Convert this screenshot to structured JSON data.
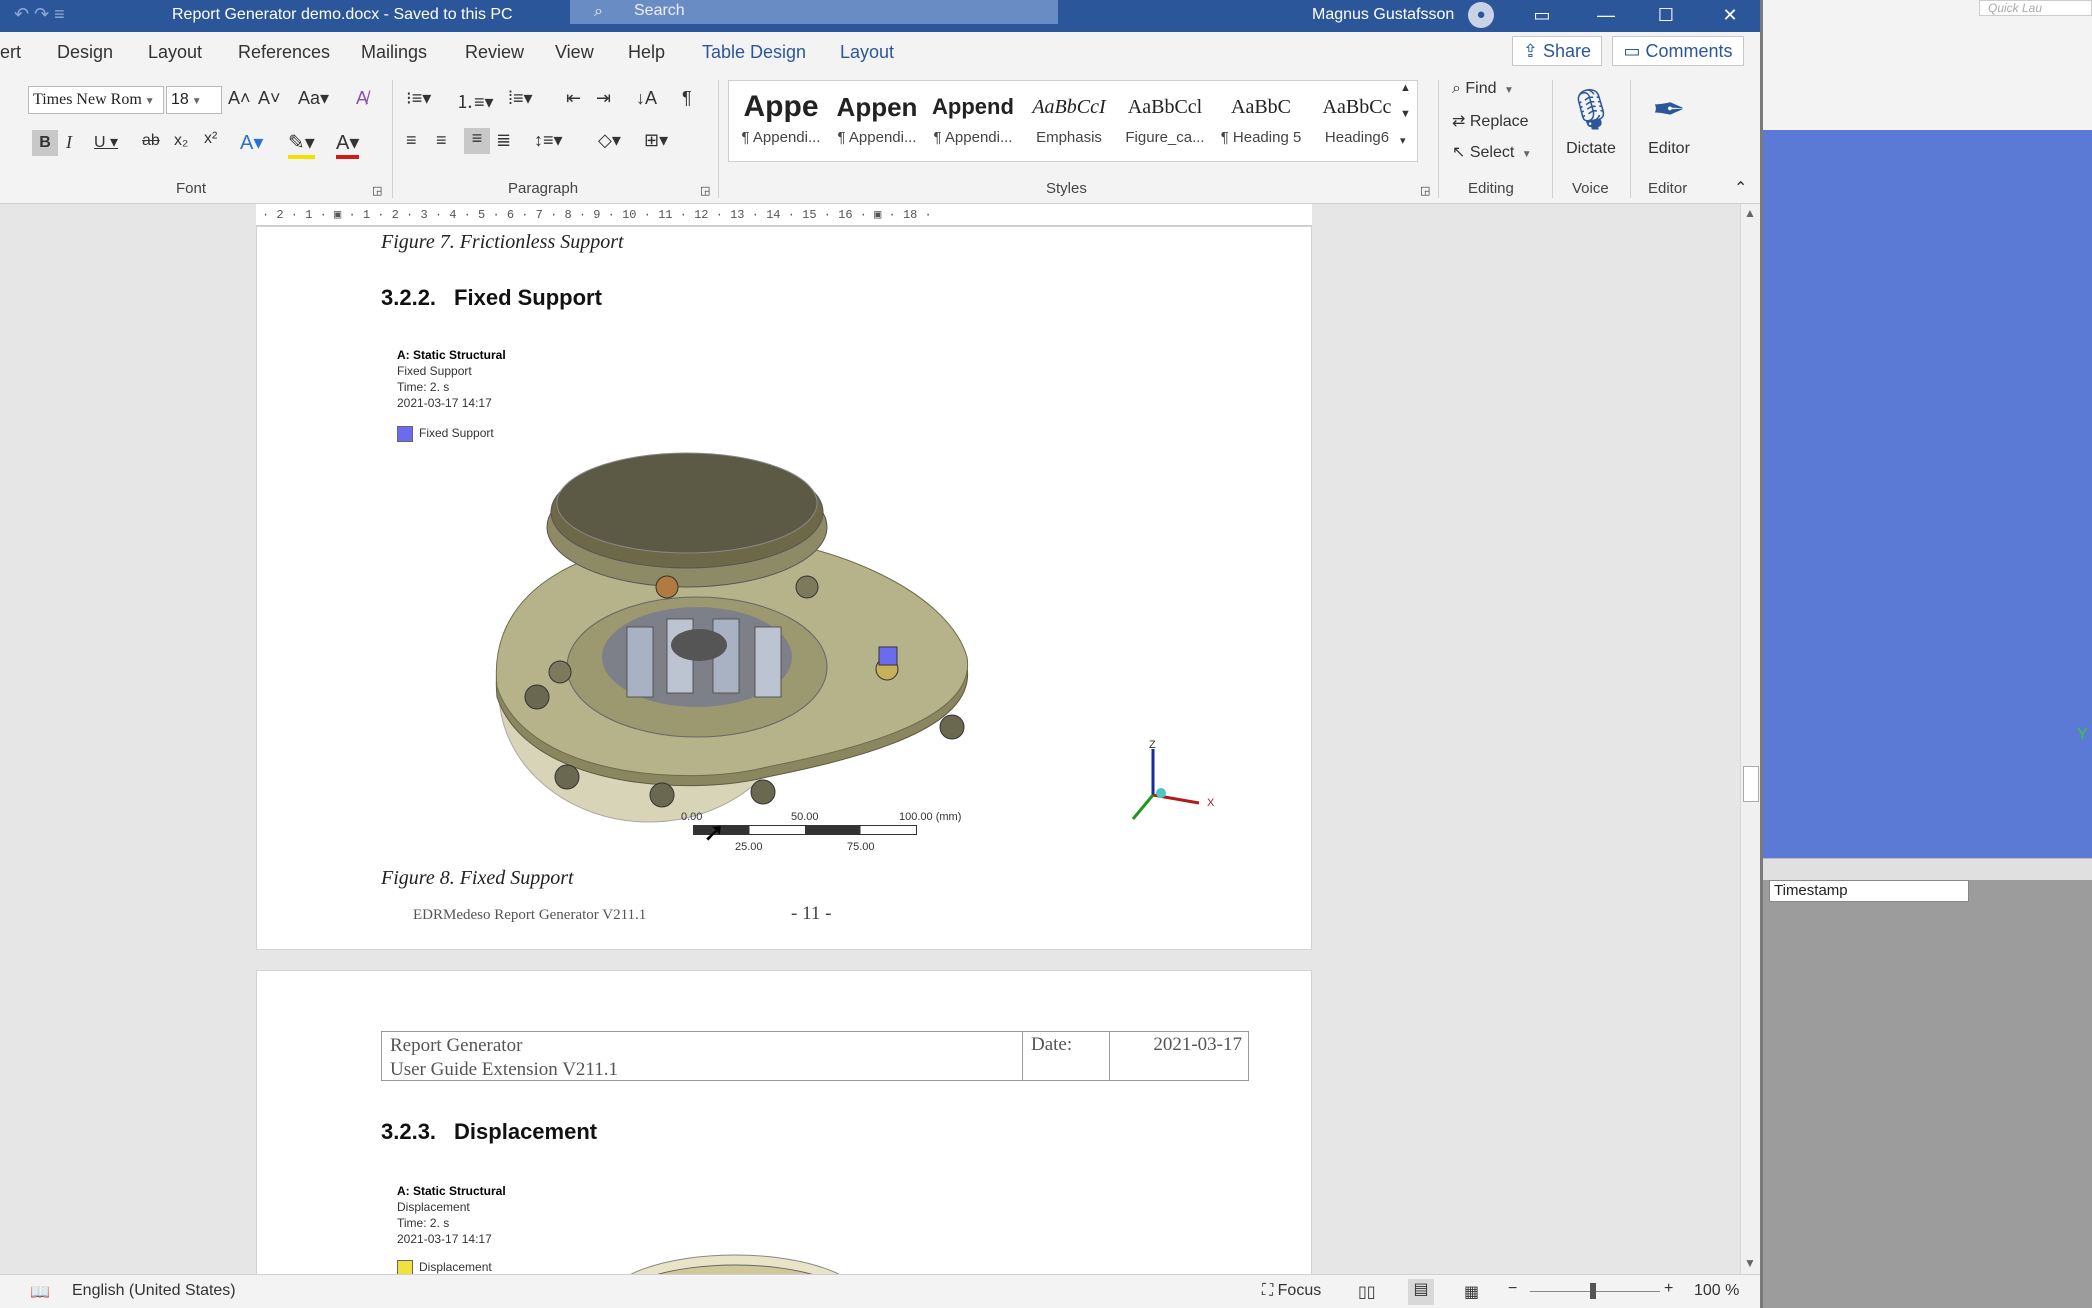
{
  "titlebar": {
    "doc_title": "Report Generator demo.docx  -  Saved to this PC",
    "search_placeholder": "Search",
    "user": "Magnus Gustafsson"
  },
  "menu": {
    "tabs": [
      "ert",
      "Design",
      "Layout",
      "References",
      "Mailings",
      "Review",
      "View",
      "Help",
      "Table Design",
      "Layout"
    ],
    "share": "Share",
    "comments": "Comments"
  },
  "ribbon": {
    "font_name": "Times New Rom",
    "font_size": "18",
    "group_font": "Font",
    "group_paragraph": "Paragraph",
    "group_styles": "Styles",
    "group_editing": "Editing",
    "group_voice": "Voice",
    "group_editor": "Editor",
    "styles": [
      {
        "preview": "Appe",
        "name": "¶ Appendi..."
      },
      {
        "preview": "Appen",
        "name": "¶ Appendi..."
      },
      {
        "preview": "Append",
        "name": "¶ Appendi..."
      },
      {
        "preview": "AaBbCcI",
        "name": "Emphasis"
      },
      {
        "preview": "AaBbCcl",
        "name": "Figure_ca..."
      },
      {
        "preview": "AaBbC",
        "name": "¶ Heading 5"
      },
      {
        "preview": "AaBbCc",
        "name": "Heading6"
      }
    ],
    "find": "Find",
    "replace": "Replace",
    "select": "Select",
    "dictate": "Dictate",
    "editor": "Editor"
  },
  "ruler": "· 2 · 1 · ▣ · 1 · 2 · 3 · 4 · 5 · 6 · 7 · 8 · 9 · 10 · 11 · 12 · 13 · 14 · 15 · 16 · ▣ · 18 ·",
  "page1": {
    "caption_top": "Figure 7. Frictionless Support",
    "heading_num": "3.2.2.",
    "heading_text": "Fixed Support",
    "fig_title": "A: Static Structural",
    "fig_sub": "Fixed Support",
    "fig_time": "Time: 2. s",
    "fig_date": "2021-03-17 14:17",
    "fig_legend": "Fixed Support",
    "scale_labels": [
      "0.00",
      "50.00",
      "100.00 (mm)",
      "25.00",
      "75.00"
    ],
    "axes": {
      "z": "Z",
      "x": "X"
    },
    "caption_bottom": "Figure 8. Fixed Support",
    "footer": "EDRMedeso Report Generator V211.1",
    "page_num": "- 11 -"
  },
  "page2": {
    "header_line1": "Report Generator",
    "header_line2": "User Guide Extension V211.1",
    "header_date_label": "Date:",
    "header_date": "2021-03-17",
    "heading_num": "3.2.3.",
    "heading_text": "Displacement",
    "fig_title": "A: Static Structural",
    "fig_sub": "Displacement",
    "fig_time": "Time: 2. s",
    "fig_date": "2021-03-17 14:17",
    "fig_legend": "Displacement"
  },
  "statusbar": {
    "language": "English (United States)",
    "focus": "Focus",
    "zoom": "100 %"
  },
  "rightapp": {
    "quick_launch": "Quick Lau",
    "timestamp": "Timestamp",
    "axis_y": "Y"
  },
  "colors": {
    "title_bar": "#2b579a",
    "fixed_support": "#6b6bf0",
    "displacement": "#f0e040",
    "right_viewport": "#5a7ad6"
  }
}
